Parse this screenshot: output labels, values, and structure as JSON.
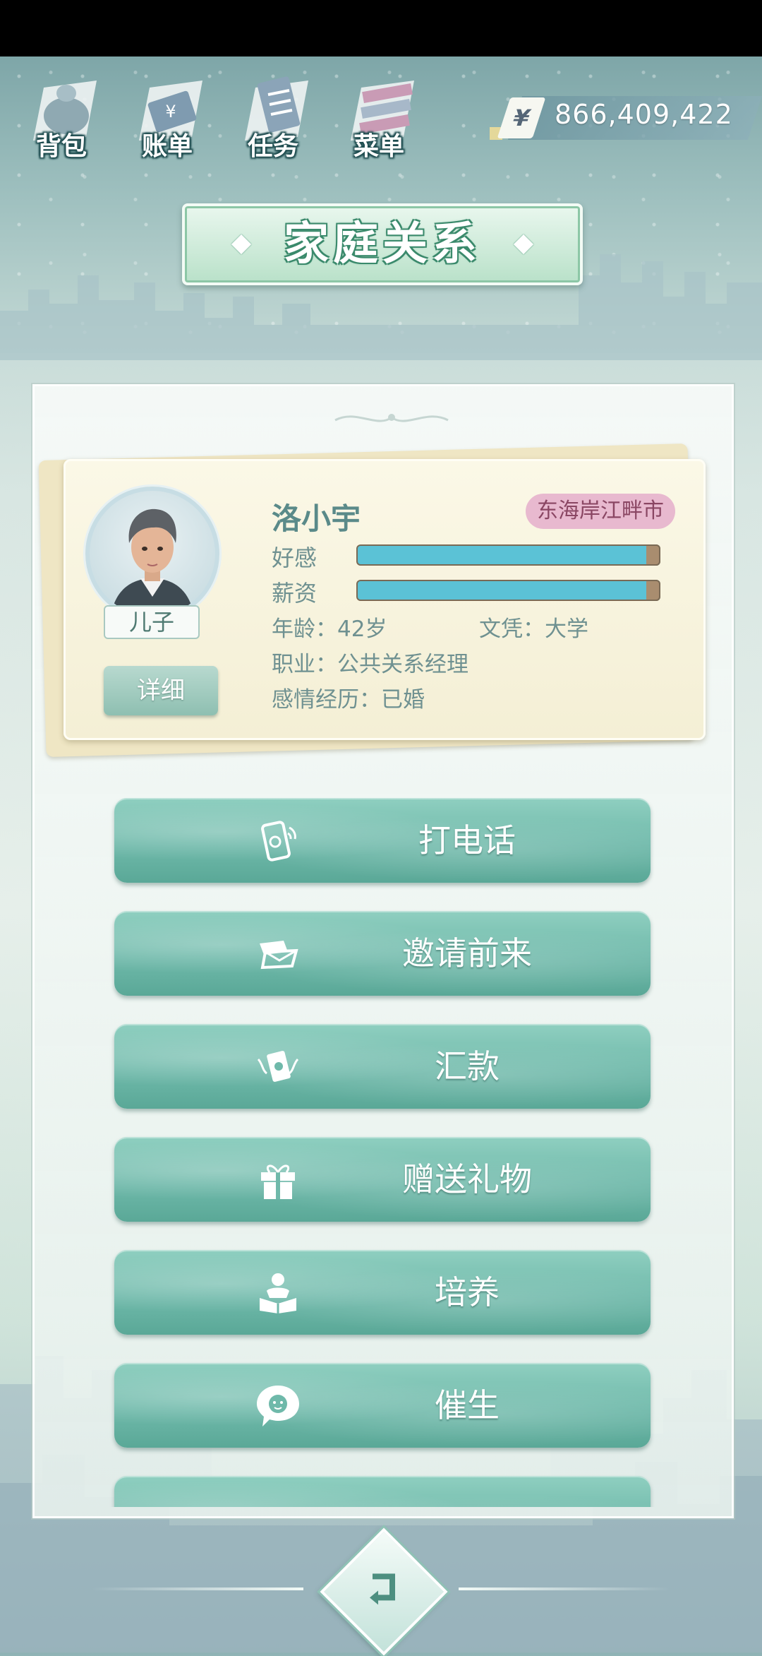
{
  "nav": {
    "items": [
      {
        "label": "背包",
        "icon": "bag-icon"
      },
      {
        "label": "账单",
        "icon": "bill-icon"
      },
      {
        "label": "任务",
        "icon": "task-icon"
      },
      {
        "label": "菜单",
        "icon": "menu-icon"
      }
    ],
    "currency_symbol": "¥",
    "money": "866,409,422"
  },
  "title": "家庭关系",
  "profile": {
    "name": "洛小宇",
    "location": "东海岸江畔市",
    "relation": "儿子",
    "detail_label": "详细",
    "affection_label": "好感",
    "affection_level": 0.98,
    "salary_label": "薪资",
    "salary_level": 0.98,
    "age": "年龄：42岁",
    "education": "文凭：大学",
    "job": "职业：公共关系经理",
    "relationship": "感情经历：已婚"
  },
  "actions": [
    {
      "label": "打电话",
      "icon": "phone-icon"
    },
    {
      "label": "邀请前来",
      "icon": "invite-letter-icon"
    },
    {
      "label": "汇款",
      "icon": "money-transfer-icon"
    },
    {
      "label": "赠送礼物",
      "icon": "gift-icon"
    },
    {
      "label": "培养",
      "icon": "reading-person-icon"
    },
    {
      "label": "催生",
      "icon": "baby-bubble-icon"
    }
  ],
  "colors": {
    "accent": "#6fb9aa",
    "bar": "#5bc2d6",
    "location_badge": "#e8b9cf",
    "title_text_outline": "#3b8a6c"
  }
}
